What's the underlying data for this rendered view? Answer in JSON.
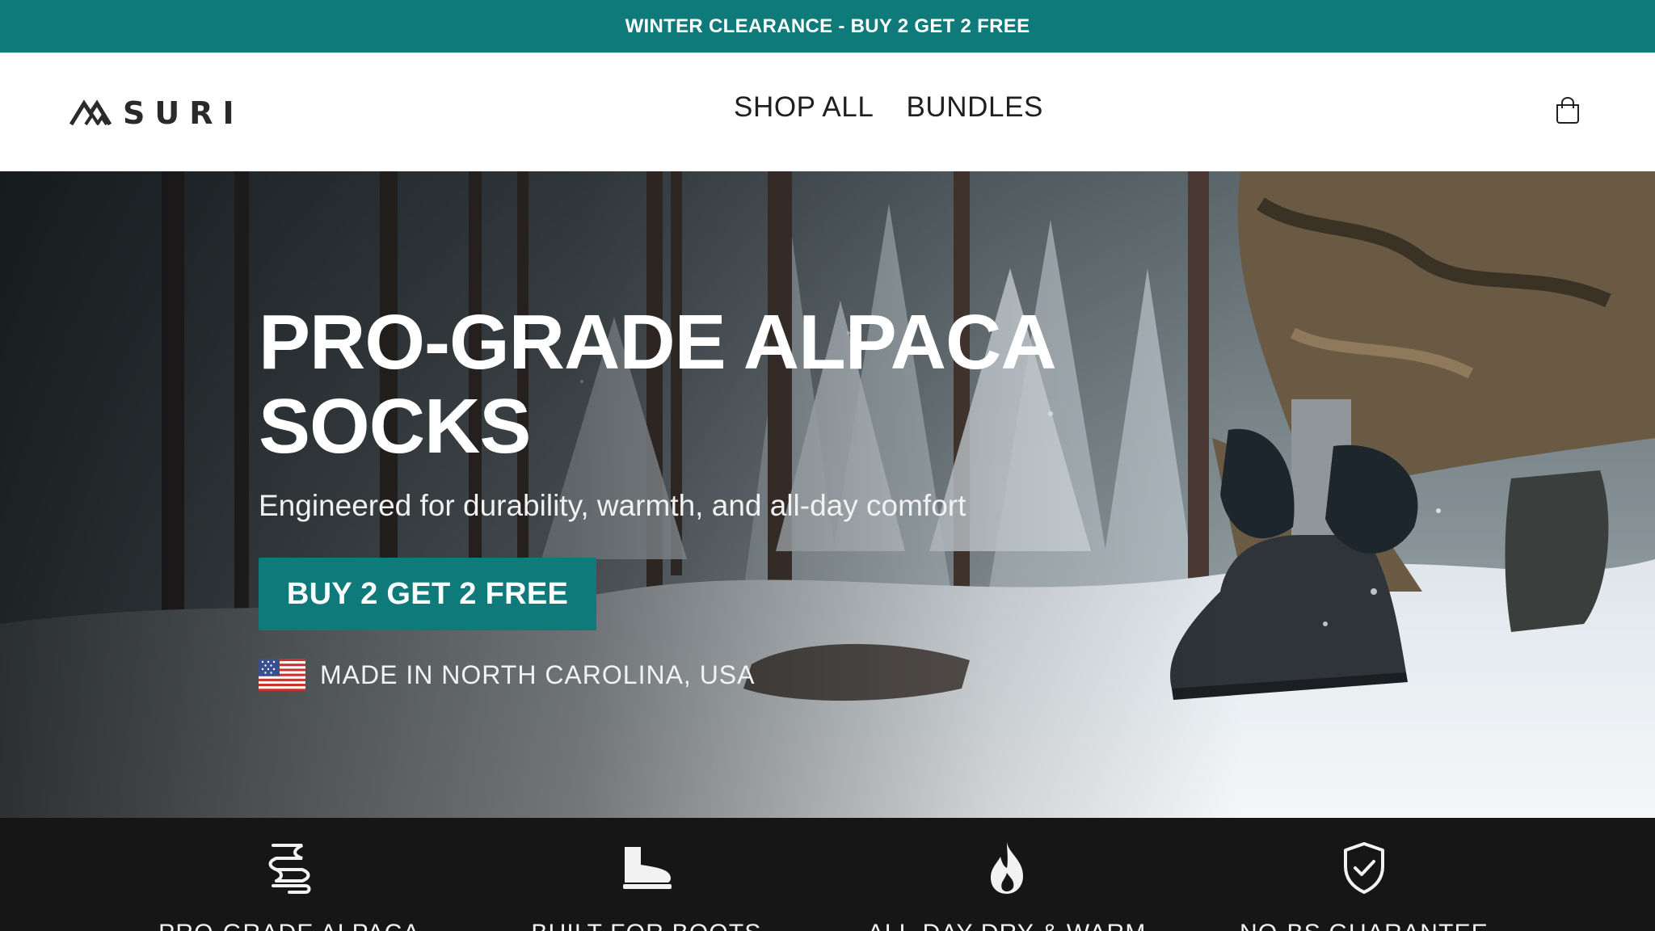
{
  "announcement": {
    "text": "WINTER CLEARANCE - BUY 2 GET 2 FREE"
  },
  "header": {
    "logo_text": "SURI",
    "nav": [
      {
        "label": "SHOP ALL"
      },
      {
        "label": "BUNDLES"
      }
    ],
    "cart_icon": "cart-bag-icon"
  },
  "hero": {
    "title_line1": "PRO-GRADE ALPACA",
    "title_line2": "SOCKS",
    "subtitle": "Engineered for durability, warmth, and all-day comfort",
    "cta_label": "BUY 2 GET 2 FREE",
    "made_in": "MADE IN NORTH CAROLINA, USA",
    "flag_icon": "us-flag-icon"
  },
  "features": [
    {
      "icon": "fiber-spool-icon",
      "label": "PRO-GRADE ALPACA"
    },
    {
      "icon": "boot-icon",
      "label": "BUILT FOR BOOTS"
    },
    {
      "icon": "flame-icon",
      "label": "ALL-DAY DRY & WARM"
    },
    {
      "icon": "shield-check-icon",
      "label": "NO-BS GUARANTEE"
    }
  ],
  "colors": {
    "accent": "#0e7a7a",
    "dark": "#161616",
    "white": "#ffffff"
  }
}
